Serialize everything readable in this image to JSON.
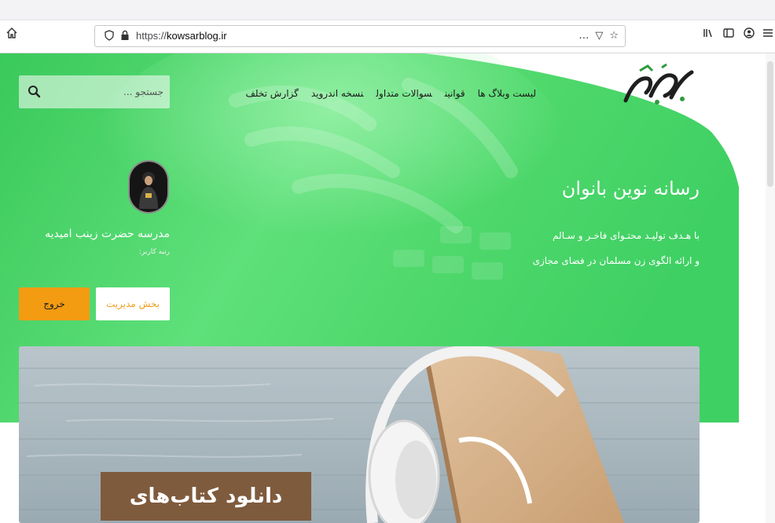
{
  "browser": {
    "url_scheme": "https://",
    "url_host": "kowsarblog.ir",
    "icons": {
      "home": "home-icon",
      "shield": "shield-icon",
      "lock": "lock-icon",
      "more": "more-icon",
      "pocket": "pocket-icon",
      "bookmark": "star-icon",
      "library": "library-icon",
      "sidebar": "sidebar-icon",
      "account": "account-icon",
      "menu": "menu-icon"
    },
    "more_label": "…",
    "pocket_label": "▽",
    "star_label": "☆"
  },
  "header": {
    "nav": [
      "لیست وبلاگ ها",
      "قوانین",
      "سوالات متداول",
      "نسخه اندروید",
      "گزارش تخلف"
    ],
    "search_placeholder": "جستجو ..."
  },
  "hero": {
    "tagline": "رسانه نوین بانوان",
    "desc_line1": "با هـدف تولیـد محتـوای فاخـر و سـالم",
    "desc_line2": "و ارائه الگوی زن مسلمان در فضای مجازی"
  },
  "profile": {
    "name": "مدرسه حضرت زینب امیدیه",
    "rank_label": "رتبه کاربر:",
    "admin_button": "بخش مدیریت",
    "logout_button": "خروج"
  },
  "banner": {
    "title": "دانلود کتاب‌های صوتی"
  },
  "colors": {
    "hero_green": "#3fd063",
    "hero_green_light": "#7ef093",
    "accent_orange": "#f39c12",
    "banner_title_bg": "#7f5b3d"
  }
}
